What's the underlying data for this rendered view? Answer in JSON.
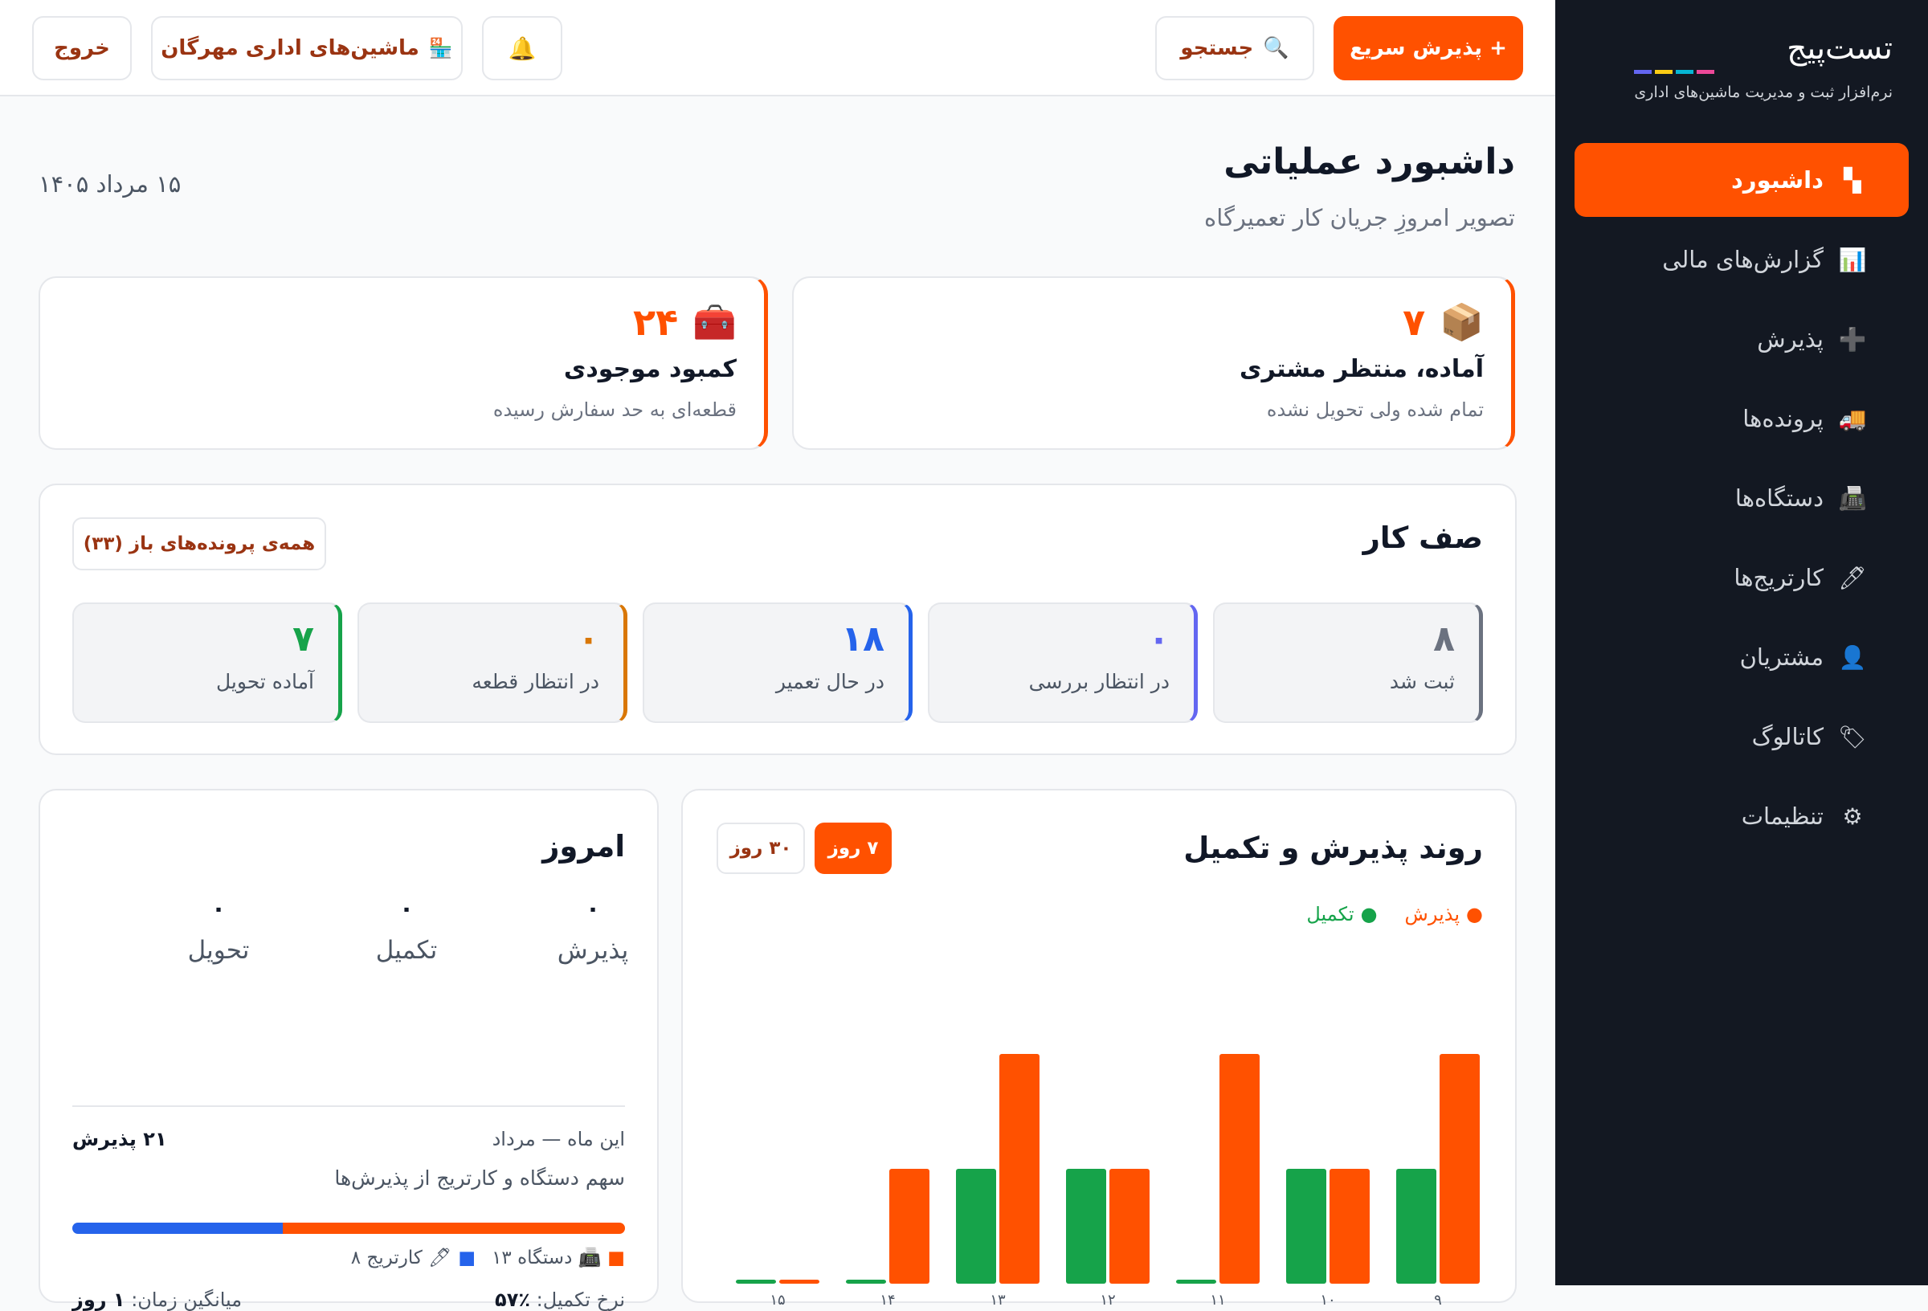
{
  "sidebar": {
    "brand_logo": "تست‌پیج",
    "brand_colors": [
      "#ec4899",
      "#06b6d4",
      "#facc15",
      "#6366f1"
    ],
    "brand_subtitle": "نرم‌افزار ثبت و مدیریت ماشین‌های اداری",
    "items": [
      {
        "label": "داشبورد",
        "icon": "dashboard-icon",
        "glyph": "▚",
        "active": true
      },
      {
        "label": "گزارش‌های مالی",
        "icon": "chart-icon",
        "glyph": "📊",
        "active": false
      },
      {
        "label": "پذیرش",
        "icon": "plus-icon",
        "glyph": "➕",
        "active": false
      },
      {
        "label": "پرونده‌ها",
        "icon": "truck-icon",
        "glyph": "🚚",
        "active": false
      },
      {
        "label": "دستگاه‌ها",
        "icon": "printer-icon",
        "glyph": "📠",
        "active": false
      },
      {
        "label": "کارتریج‌ها",
        "icon": "pen-icon",
        "glyph": "🖊",
        "active": false
      },
      {
        "label": "مشتریان",
        "icon": "user-icon",
        "glyph": "👤",
        "active": false
      },
      {
        "label": "کاتالوگ",
        "icon": "ticket-icon",
        "glyph": "🏷",
        "active": false
      },
      {
        "label": "تنظیمات",
        "icon": "gear-icon",
        "glyph": "⚙",
        "active": false
      }
    ]
  },
  "topbar": {
    "quick_accept": "+ پذیرش سریع",
    "search": "جستجو",
    "store": "ماشین‌های اداری مهرگان",
    "logout": "خروج"
  },
  "page": {
    "title": "داشبورد عملیاتی",
    "subtitle": "تصویر امروزِ جریان کار تعمیرگاه",
    "date": "۱۵ مرداد ۱۴۰۵"
  },
  "alerts": [
    {
      "number": "۷",
      "title": "آماده، منتظر مشتری",
      "desc": "تمام شده ولی تحویل نشده",
      "icon": "package-icon",
      "glyph": "📦"
    },
    {
      "number": "۲۴",
      "title": "کمبود موجودی",
      "desc": "قطعه‌ای به حد سفارش رسیده",
      "icon": "toolbox-icon",
      "glyph": "🧰"
    }
  ],
  "queue": {
    "title": "صف کار",
    "all_open": "همه‌ی پرونده‌های باز (۳۳)",
    "statuses": [
      {
        "count": "۸",
        "label": "ثبت شد",
        "color": "#6b7280"
      },
      {
        "count": "۰",
        "label": "در انتظار بررسی",
        "color": "#6366f1"
      },
      {
        "count": "۱۸",
        "label": "در حال تعمیر",
        "color": "#2563eb"
      },
      {
        "count": "۰",
        "label": "در انتظار قطعه",
        "color": "#d97706"
      },
      {
        "count": "۷",
        "label": "آماده تحویل",
        "color": "#16a34a"
      }
    ]
  },
  "trend": {
    "title": "روند پذیرش و تکمیل",
    "range_7": "۷ روز",
    "range_30": "۳۰ روز",
    "selected_range": "۷ روز"
  },
  "chart_data": {
    "type": "bar",
    "categories": [
      "۹",
      "۱۰",
      "۱۱",
      "۱۲",
      "۱۳",
      "۱۴",
      "۱۵"
    ],
    "series": [
      {
        "name": "پذیرش",
        "color": "#ff5100",
        "values": [
          4,
          2,
          4,
          2,
          4,
          2,
          0
        ]
      },
      {
        "name": "تکمیل",
        "color": "#16a34a",
        "values": [
          2,
          2,
          0,
          2,
          2,
          0,
          0
        ]
      }
    ],
    "ylim": [
      0,
      4
    ],
    "grid": false,
    "legend": "top-right"
  },
  "today": {
    "title": "امروز",
    "stats": [
      {
        "value": "۰",
        "label": "پذیرش"
      },
      {
        "value": "۰",
        "label": "تکمیل"
      },
      {
        "value": "۰",
        "label": "تحویل"
      }
    ],
    "month_label": "این ماه — مرداد",
    "month_count": "۲۱ پذیرش",
    "share_label": "سهم دستگاه و کارتریج از پذیرش‌ها",
    "device_share": 0.619,
    "legend_device": "📠 دستگاه ۱۳",
    "legend_cartridge": "🖊 کارتریج ۸",
    "device_color": "#ff5100",
    "cartridge_color": "#2563eb",
    "completion_label": "نرخ تکمیل:",
    "completion_value": "٪۵۷",
    "avg_time_label": "میانگین زمان:",
    "avg_time_value": "۱ روز"
  }
}
